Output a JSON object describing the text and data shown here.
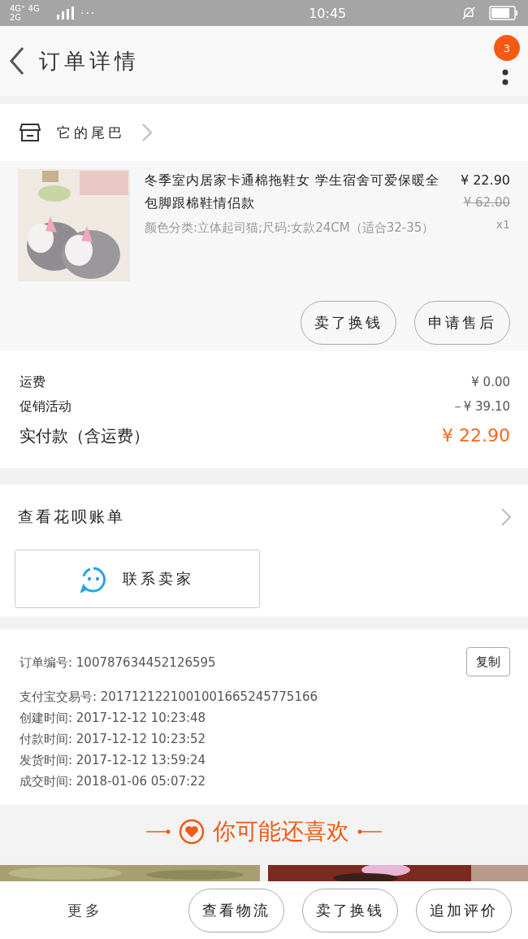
{
  "status_bar": {
    "network": "4G⁺ 4G 2G",
    "time": "10:45",
    "more": "···"
  },
  "header": {
    "title": "订单详情",
    "badge": "3"
  },
  "store": {
    "name": "它的尾巴"
  },
  "product": {
    "kind": "picture",
    "title": "冬季室内居家卡通棉拖鞋女 学生宿舍可爱保暖全包脚跟棉鞋情侣款",
    "spec": "颜色分类:立体起司猫;尺码:女款24CM（适合32-35）",
    "price": "¥ 22.90",
    "original_price": "¥ 62.00",
    "quantity": "x1",
    "actions": [
      "卖了换钱",
      "申请售后"
    ]
  },
  "summary": [
    {
      "label": "运费",
      "value": "¥ 0.00",
      "kind": "plain"
    },
    {
      "label": "促销活动",
      "value": "－¥ 39.10",
      "kind": "plain"
    },
    {
      "label": "实付款（含运费）",
      "value": "¥ 22.90",
      "kind": "total"
    }
  ],
  "huabei": {
    "label": "查看花呗账单"
  },
  "contact": {
    "label": "联系卖家"
  },
  "order_info": {
    "copy": "复制",
    "rows": [
      {
        "label": "订单编号:",
        "value": "100787634452126595"
      },
      {
        "label": "支付宝交易号:",
        "value": "2017121221001001665245775166"
      },
      {
        "label": "创建时间:",
        "value": "2017-12-12 10:23:48"
      },
      {
        "label": "付款时间:",
        "value": "2017-12-12 10:23:52"
      },
      {
        "label": "发货时间:",
        "value": "2017-12-12 13:59:24"
      },
      {
        "label": "成交时间:",
        "value": "2018-01-06 05:07:22"
      }
    ]
  },
  "recommend": {
    "title": "你可能还喜欢"
  },
  "bottom_bar": {
    "more": "更多",
    "buttons": [
      "查看物流",
      "卖了换钱",
      "追加评价"
    ]
  }
}
